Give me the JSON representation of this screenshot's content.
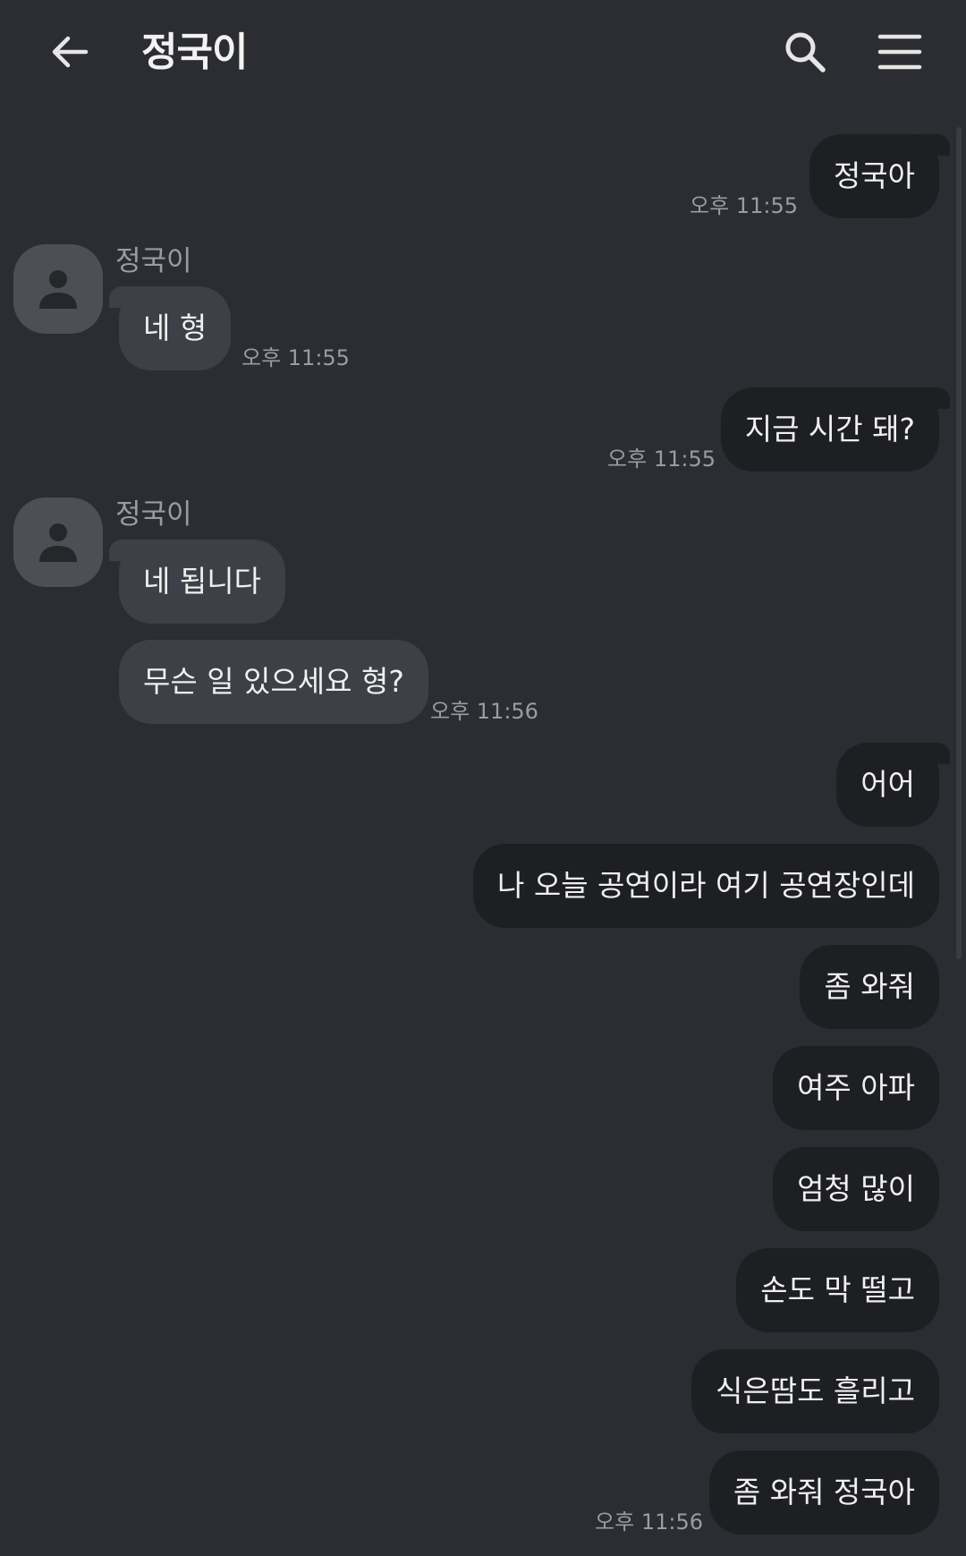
{
  "header": {
    "title": "정국이",
    "back_icon": "arrow-left-icon",
    "search_icon": "search-icon",
    "menu_icon": "hamburger-menu-icon"
  },
  "colors": {
    "background": "#2b2d32",
    "sent_bubble": "#1e1f23",
    "received_bubble": "#3d4046",
    "avatar": "#4c4f56",
    "timestamp": "#9a9ca1"
  },
  "messages": [
    {
      "side": "sent",
      "text": "정국아",
      "time": "오후 11:55"
    },
    {
      "side": "received",
      "sender": "정국이",
      "text": "네 형",
      "time": "오후 11:55"
    },
    {
      "side": "sent",
      "text": "지금 시간 돼?",
      "time": "오후 11:55"
    },
    {
      "side": "received",
      "sender": "정국이",
      "text": "네 됩니다"
    },
    {
      "side": "received",
      "text": "무슨 일 있으세요 형?",
      "time": "오후 11:56"
    },
    {
      "side": "sent",
      "text": "어어"
    },
    {
      "side": "sent",
      "text": "나 오늘 공연이라 여기 공연장인데"
    },
    {
      "side": "sent",
      "text": "좀 와줘"
    },
    {
      "side": "sent",
      "text": "여주 아파"
    },
    {
      "side": "sent",
      "text": "엄청 많이"
    },
    {
      "side": "sent",
      "text": "손도 막 떨고"
    },
    {
      "side": "sent",
      "text": "식은땀도 흘리고"
    },
    {
      "side": "sent",
      "text": "좀 와줘 정국아",
      "time": "오후 11:56"
    }
  ]
}
